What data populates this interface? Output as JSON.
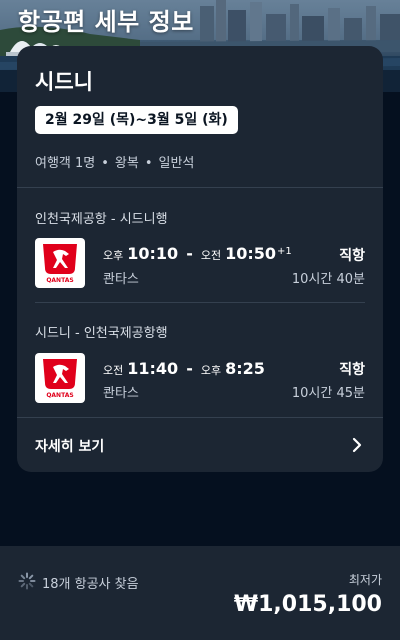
{
  "page": {
    "title": "항공편 세부 정보"
  },
  "trip": {
    "destination": "시드니",
    "dates": "2월 29일 (목)~3월 5일 (화)",
    "travelers": "여행객 1명",
    "trip_type": "왕복",
    "cabin": "일반석",
    "separator": "•"
  },
  "legs": [
    {
      "route": "인천국제공항 - 시드니행",
      "depart_ampm": "오후",
      "depart_time": "10:10",
      "arrive_ampm": "오전",
      "arrive_time": "10:50",
      "day_offset": "+1",
      "airline": "콴타스",
      "stops": "직항",
      "duration": "10시간 40분",
      "logo_text": "QANTAS",
      "logo_icon": "qantas-kangaroo-icon"
    },
    {
      "route": "시드니 - 인천국제공항행",
      "depart_ampm": "오전",
      "depart_time": "11:40",
      "arrive_ampm": "오후",
      "arrive_time": "8:25",
      "day_offset": "",
      "airline": "콴타스",
      "stops": "직항",
      "duration": "10시간 45분",
      "logo_text": "QANTAS",
      "logo_icon": "qantas-kangaroo-icon"
    }
  ],
  "time_dash": "-",
  "details": {
    "label": "자세히 보기",
    "icon": "chevron-right-icon"
  },
  "footer": {
    "found_text": "18개 항공사 찾음",
    "loading_icon": "loading-spinner-icon",
    "lowest_label": "최저가",
    "price": "₩1,015,100"
  },
  "colors": {
    "background": "#05101f",
    "card": "#1c2633",
    "qantas_red": "#e0001b"
  }
}
